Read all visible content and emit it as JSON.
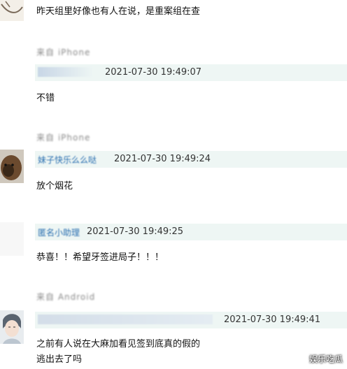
{
  "comments": [
    {
      "text": "昨天组里好像也有人在说，是重案组在查"
    },
    {
      "header": "来自 iPhone",
      "user": " ",
      "time": "2021-07-30 19:49:07",
      "text": "不错"
    },
    {
      "header": "来自 iPhone",
      "user": "妹子快乐么么哒",
      "time": "2021-07-30 19:49:24",
      "text": "放个烟花"
    },
    {
      "header": "",
      "user": "匿名小助理",
      "time": "2021-07-30 19:49:25",
      "text": "恭喜！！希望牙签进局子！！！"
    },
    {
      "header": "来自 Android",
      "user": " ",
      "time": "2021-07-30 19:49:41",
      "text": "之前有人说在大麻加看见签到底真的假的\n逃出去了吗"
    }
  ],
  "watermark": "娱乐吃瓜"
}
